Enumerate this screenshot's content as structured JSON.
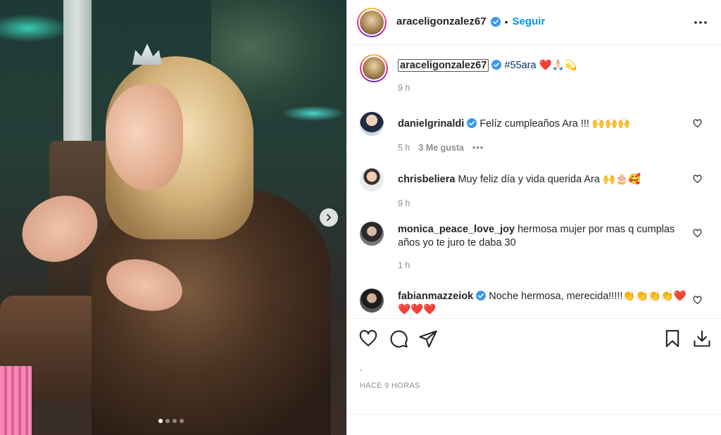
{
  "post_author": {
    "username": "araceligonzalez67",
    "separator": "•",
    "follow_label": "Seguir"
  },
  "caption": {
    "username": "araceligonzalez67",
    "hashtag": "#55ara",
    "emojis": "❤️🙏🏻💫",
    "time": "9 h"
  },
  "comments": [
    {
      "username": "danielgrinaldi",
      "verified": true,
      "text": "Felíz cumpleaños Ara !!! 🙌🙌🙌",
      "time": "5 h",
      "likes": "3 Me gusta",
      "options": "•••"
    },
    {
      "username": "chrisbeliera",
      "verified": false,
      "text": "Muy feliz día y vida querida Ara 🙌🎂🥰",
      "time": "9 h"
    },
    {
      "username": "monica_peace_love_joy",
      "verified": false,
      "text": "hermosa mujer por mas q cumplas años yo te juro te daba 30",
      "time": "1 h"
    },
    {
      "username": "fabianmazzeiok",
      "verified": true,
      "text": "Noche hermosa, merecida!!!!!👏👏👏👏❤️❤️❤️❤️"
    }
  ],
  "footer": {
    "tick": "ˋ",
    "posted_ago": "HACE 9 HORAS"
  },
  "icons": {
    "more": "more-options-icon",
    "like": "heart-icon",
    "comment": "comment-icon",
    "share": "share-icon",
    "save": "bookmark-icon",
    "download": "download-icon",
    "next": "chevron-right-icon"
  },
  "colors": {
    "accent": "#0095f6",
    "verified": "#3897f0",
    "hashtag": "#00376b",
    "muted": "#8e8e8e"
  },
  "carousel": {
    "slides": 4,
    "active": 1
  }
}
